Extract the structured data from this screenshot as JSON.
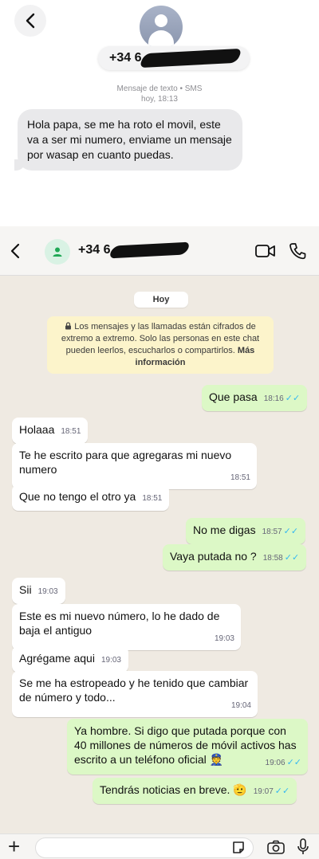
{
  "sms": {
    "contact_number": "+34 6",
    "header_line": "Mensaje de texto • SMS",
    "timestamp": "hoy, 18:13",
    "message": "Hola papa, se me ha roto el movil, este va a ser mi numero, enviame un mensaje por wasap en cuanto puedas."
  },
  "whatsapp": {
    "contact_number": "+34 6",
    "date_pill": "Hoy",
    "encryption_notice": "Los mensajes y las llamadas están cifrados de extremo a extremo. Solo las personas en este chat pueden leerlos, escucharlos o compartirlos.",
    "more_info": "Más información",
    "messages": [
      {
        "text": "Que pasa",
        "time": "18:16",
        "dir": "out"
      },
      {
        "text": "Holaaa",
        "time": "18:51",
        "dir": "in"
      },
      {
        "text": "Te he escrito para que agregaras mi nuevo numero",
        "time": "18:51",
        "dir": "in"
      },
      {
        "text": "Que no tengo el otro ya",
        "time": "18:51",
        "dir": "in"
      },
      {
        "text": "No me digas",
        "time": "18:57",
        "dir": "out"
      },
      {
        "text": "Vaya putada no ?",
        "time": "18:58",
        "dir": "out"
      },
      {
        "text": "Sii",
        "time": "19:03",
        "dir": "in"
      },
      {
        "text": "Este es mi nuevo número, lo he dado de baja el antiguo",
        "time": "19:03",
        "dir": "in"
      },
      {
        "text": "Agrégame aqui",
        "time": "19:03",
        "dir": "in"
      },
      {
        "text": "Se me ha estropeado y he tenido que cambiar de número y todo...",
        "time": "19:04",
        "dir": "in"
      },
      {
        "text": "Ya hombre. Si digo que putada porque con 40 millones de números de móvil activos has escrito a un teléfono oficial 👮",
        "time": "19:06",
        "dir": "out"
      },
      {
        "text": "Tendrás noticias en breve. 🫡",
        "time": "19:07",
        "dir": "out"
      }
    ],
    "colors": {
      "chat_background": "#efeae2",
      "outgoing_bubble": "#dcf8c6",
      "incoming_bubble": "#ffffff",
      "notice_background": "#fcf4cb",
      "read_ticks": "#34b7f1",
      "sms_bubble": "#e9e9eb"
    },
    "icons": [
      "back-icon",
      "contact-avatar-icon",
      "video-call-icon",
      "phone-call-icon",
      "lock-icon",
      "read-receipt-icon",
      "plus-icon",
      "sticker-icon",
      "camera-icon",
      "microphone-icon"
    ]
  }
}
